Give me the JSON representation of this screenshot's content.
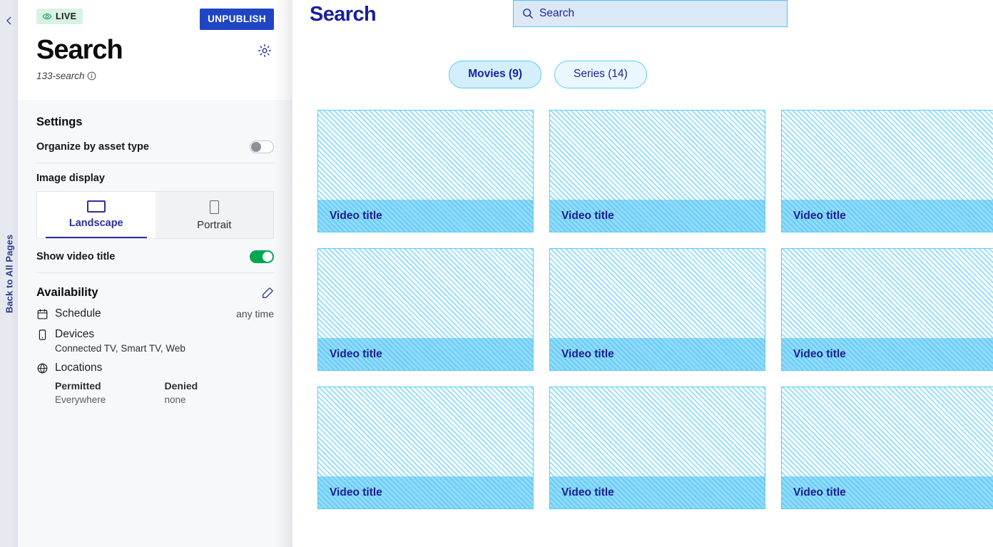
{
  "rail": {
    "collapse_icon": "chevron-left-icon",
    "back_label": "Back to All Pages"
  },
  "sidebar": {
    "status_badge": {
      "label": "LIVE",
      "icon": "eye-icon",
      "bg": "#d9f2e4",
      "fg": "#12a05c"
    },
    "unpublish_label": "UNPUBLISH",
    "unpublish_bg": "#1f45c4",
    "page_title": "Search",
    "gear_icon": "gear-icon",
    "slug": "133-search",
    "info_icon": "info-icon",
    "settings": {
      "title": "Settings",
      "organize_label": "Organize by asset type",
      "organize_state": "off",
      "image_display_label": "Image display",
      "options": [
        {
          "label": "Landscape",
          "icon": "landscape-rectangle-icon",
          "selected": true
        },
        {
          "label": "Portrait",
          "icon": "portrait-rectangle-icon",
          "selected": false
        }
      ],
      "show_title_label": "Show video title",
      "show_title_state": "on",
      "toggle_on_color": "#00a651"
    },
    "availability": {
      "title": "Availability",
      "edit_icon": "edit-pencil-icon",
      "schedule": {
        "icon": "calendar-icon",
        "label": "Schedule",
        "value": "any time"
      },
      "devices": {
        "icon": "device-icon",
        "label": "Devices",
        "value": "Connected TV, Smart TV, Web"
      },
      "locations": {
        "icon": "globe-icon",
        "label": "Locations",
        "permitted_header": "Permitted",
        "permitted_value": "Everywhere",
        "denied_header": "Denied",
        "denied_value": "none"
      }
    }
  },
  "main": {
    "title": "Search",
    "title_color": "#1a1f9e",
    "search": {
      "icon": "search-icon",
      "placeholder": "Search",
      "value": ""
    },
    "chips": [
      {
        "label": "Movies (9)",
        "selected": true
      },
      {
        "label": "Series (14)",
        "selected": false
      }
    ],
    "cards": [
      {
        "title": "Video title"
      },
      {
        "title": "Video title"
      },
      {
        "title": "Video title"
      },
      {
        "title": "Video title"
      },
      {
        "title": "Video title"
      },
      {
        "title": "Video title"
      },
      {
        "title": "Video title"
      },
      {
        "title": "Video title"
      },
      {
        "title": "Video title"
      }
    ]
  }
}
